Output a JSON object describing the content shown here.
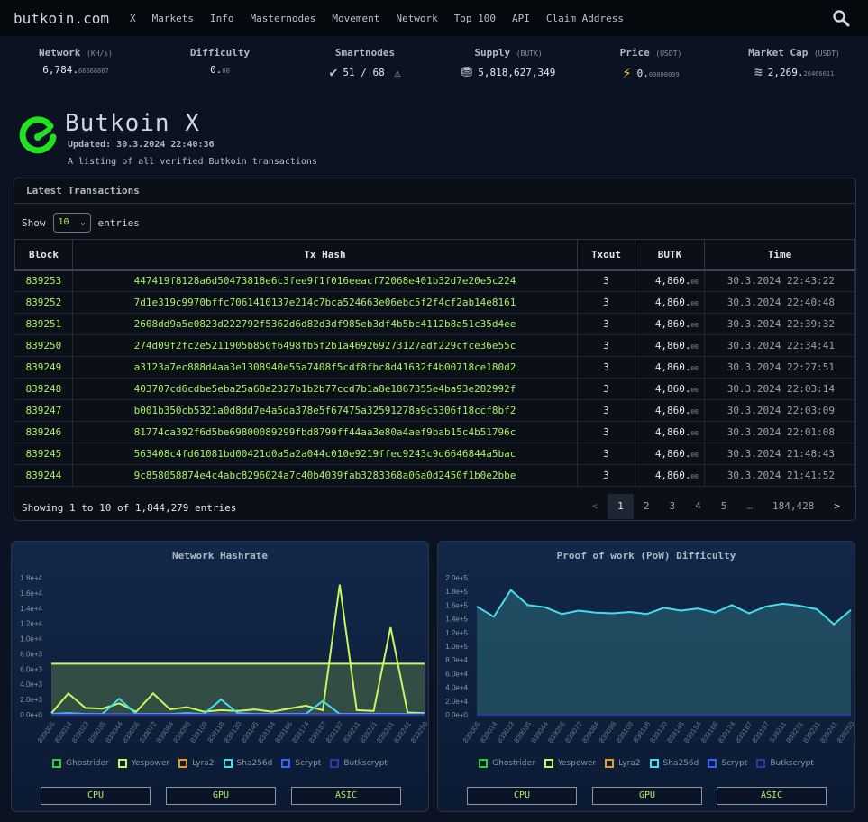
{
  "nav": {
    "brand": "butkoin.com",
    "links": [
      "X",
      "Markets",
      "Info",
      "Masternodes",
      "Movement",
      "Network",
      "Top 100",
      "API",
      "Claim Address"
    ]
  },
  "stats": {
    "network": {
      "label": "Network",
      "unit": "(KH/s)",
      "value": "6,784.",
      "decimals": "66666667"
    },
    "difficulty": {
      "label": "Difficulty",
      "value": "0.",
      "decimals": "00"
    },
    "smartnodes": {
      "label": "Smartnodes",
      "value": "51 / 68"
    },
    "supply": {
      "label": "Supply",
      "unit": "(BUTK)",
      "value": "5,818,627,349"
    },
    "price": {
      "label": "Price",
      "unit": "(USDT)",
      "value": "0.",
      "decimals": "00000039"
    },
    "marketcap": {
      "label": "Market Cap",
      "unit": "(USDT)",
      "value": "2,269.",
      "decimals": "26466611"
    }
  },
  "page": {
    "title": "Butkoin X",
    "updated": "Updated: 30.3.2024 22:40:36",
    "description": "A listing of all verified Butkoin transactions"
  },
  "transactions": {
    "heading": "Latest Transactions",
    "show_label": "Show",
    "entries_label": "entries",
    "page_size": "10",
    "columns": [
      "Block",
      "Tx Hash",
      "Txout",
      "BUTK",
      "Time"
    ],
    "rows": [
      {
        "block": "839253",
        "hash": "447419f8128a6d50473818e6c3fee9f1f016eeacf72068e401b32d7e20e5c224",
        "txout": "3",
        "amount": "4,860.",
        "dec": "00",
        "time": "30.3.2024 22:43:22"
      },
      {
        "block": "839252",
        "hash": "7d1e319c9970bffc7061410137e214c7bca524663e06ebc5f2f4cf2ab14e8161",
        "txout": "3",
        "amount": "4,860.",
        "dec": "00",
        "time": "30.3.2024 22:40:48"
      },
      {
        "block": "839251",
        "hash": "2608dd9a5e0823d222792f5362d6d82d3df985eb3df4b5bc4112b8a51c35d4ee",
        "txout": "3",
        "amount": "4,860.",
        "dec": "00",
        "time": "30.3.2024 22:39:32"
      },
      {
        "block": "839250",
        "hash": "274d09f2fc2e5211905b850f6498fb5f2b1a469269273127adf229cfce36e55c",
        "txout": "3",
        "amount": "4,860.",
        "dec": "00",
        "time": "30.3.2024 22:34:41"
      },
      {
        "block": "839249",
        "hash": "a3123a7ec888d4aa3e1308940e55a7408f5cdf8fbc8d41632f4b00718ce180d2",
        "txout": "3",
        "amount": "4,860.",
        "dec": "00",
        "time": "30.3.2024 22:27:51"
      },
      {
        "block": "839248",
        "hash": "403707cd6cdbe5eba25a68a2327b1b2b77ccd7b1a8e1867355e4ba93e282992f",
        "txout": "3",
        "amount": "4,860.",
        "dec": "00",
        "time": "30.3.2024 22:03:14"
      },
      {
        "block": "839247",
        "hash": "b001b350cb5321a0d8dd7e4a5da378e5f67475a32591278a9c5306f18ccf8bf2",
        "txout": "3",
        "amount": "4,860.",
        "dec": "00",
        "time": "30.3.2024 22:03:09"
      },
      {
        "block": "839246",
        "hash": "81774ca392f6d5be69800089299fbd8799ff44aa3e80a4aef9bab15c4b51796c",
        "txout": "3",
        "amount": "4,860.",
        "dec": "00",
        "time": "30.3.2024 22:01:08"
      },
      {
        "block": "839245",
        "hash": "563408c4fd61081bd00421d0a5a2a044c010e9219ffec9243c9d6646844a5bac",
        "txout": "3",
        "amount": "4,860.",
        "dec": "00",
        "time": "30.3.2024 21:48:43"
      },
      {
        "block": "839244",
        "hash": "9c858058874e4c4abc8296024a7c40b4039fab3283368a06a0d2450f1b0e2bbe",
        "txout": "3",
        "amount": "4,860.",
        "dec": "00",
        "time": "30.3.2024 21:41:52"
      }
    ],
    "showing": "Showing 1 to 10 of 1,844,279 entries",
    "pager": [
      "<",
      "1",
      "2",
      "3",
      "4",
      "5",
      "…",
      "184,428",
      ">"
    ],
    "active_page": "1"
  },
  "chart_data": [
    {
      "type": "line",
      "title": "Network Hashrate",
      "ylim": [
        0,
        18000
      ],
      "yticks": [
        "0.0e+0",
        "2.0e+3",
        "4.0e+3",
        "6.0e+3",
        "8.0e+3",
        "1.0e+4",
        "1.2e+4",
        "1.4e+4",
        "1.6e+4",
        "1.8e+4"
      ],
      "x_ticks": [
        "839005",
        "839014",
        "839023",
        "839035",
        "839044",
        "839056",
        "839072",
        "839084",
        "839098",
        "839109",
        "839118",
        "839130",
        "839145",
        "839154",
        "839166",
        "839174",
        "839187",
        "839197",
        "839211",
        "839221",
        "839231",
        "839241",
        "839250"
      ],
      "reference_line": 6700,
      "series": [
        {
          "name": "Ghostrider",
          "color": "#33cc33",
          "values": [
            60,
            60,
            60,
            60,
            80,
            60,
            60,
            60,
            60,
            60,
            60,
            60,
            60,
            60,
            60,
            60,
            60,
            60,
            60,
            60,
            60,
            60,
            60
          ]
        },
        {
          "name": "Yespower",
          "color": "#c8f560",
          "values": [
            200,
            2800,
            900,
            800,
            1500,
            400,
            2800,
            700,
            1000,
            400,
            600,
            500,
            700,
            400,
            800,
            1200,
            600,
            17100,
            600,
            500,
            11500,
            300,
            200
          ]
        },
        {
          "name": "Lyra2",
          "color": "#e0a030",
          "values": [
            0,
            0,
            0,
            0,
            0,
            0,
            0,
            0,
            0,
            0,
            0,
            0,
            0,
            0,
            0,
            0,
            0,
            0,
            0,
            0,
            0,
            0,
            0
          ]
        },
        {
          "name": "Sha256d",
          "color": "#44ddee",
          "values": [
            100,
            200,
            100,
            100,
            2100,
            100,
            100,
            100,
            200,
            100,
            2000,
            200,
            100,
            100,
            100,
            100,
            1800,
            100,
            100,
            100,
            100,
            100,
            100
          ]
        },
        {
          "name": "Scrypt",
          "color": "#3366ff",
          "values": [
            50,
            50,
            50,
            50,
            50,
            50,
            50,
            50,
            50,
            50,
            50,
            50,
            50,
            50,
            50,
            50,
            50,
            50,
            50,
            50,
            50,
            50,
            50
          ]
        },
        {
          "name": "Butkscrypt",
          "color": "#3333aa",
          "values": [
            0,
            0,
            0,
            0,
            0,
            0,
            0,
            0,
            0,
            0,
            0,
            0,
            0,
            0,
            0,
            0,
            0,
            0,
            0,
            0,
            0,
            0,
            0
          ]
        }
      ],
      "buttons": [
        "CPU",
        "GPU",
        "ASIC"
      ]
    },
    {
      "type": "line",
      "title": "Proof of work (PoW) Difficulty",
      "ylim": [
        0,
        200000
      ],
      "yticks": [
        "0.0e+0",
        "2.0e+4",
        "4.0e+4",
        "6.0e+4",
        "8.0e+4",
        "1.0e+5",
        "1.2e+5",
        "1.4e+5",
        "1.6e+5",
        "1.8e+5",
        "2.0e+5"
      ],
      "x_ticks": [
        "839005",
        "839014",
        "839023",
        "839035",
        "839044",
        "839056",
        "839072",
        "839084",
        "839098",
        "839109",
        "839118",
        "839130",
        "839145",
        "839154",
        "839166",
        "839174",
        "839187",
        "839197",
        "839211",
        "839221",
        "839231",
        "839241",
        "839250"
      ],
      "series": [
        {
          "name": "Ghostrider",
          "color": "#33cc33",
          "values": [
            0,
            0,
            0,
            0,
            0,
            0,
            0,
            0,
            0,
            0,
            0,
            0,
            0,
            0,
            0,
            0,
            0,
            0,
            0,
            0,
            0,
            0,
            0
          ]
        },
        {
          "name": "Yespower",
          "color": "#c8f560",
          "values": [
            0,
            0,
            0,
            0,
            0,
            0,
            0,
            0,
            0,
            0,
            0,
            0,
            0,
            0,
            0,
            0,
            0,
            0,
            0,
            0,
            0,
            0,
            0
          ]
        },
        {
          "name": "Lyra2",
          "color": "#e0a030",
          "values": [
            0,
            0,
            0,
            0,
            0,
            0,
            0,
            0,
            0,
            0,
            0,
            0,
            0,
            0,
            0,
            0,
            0,
            0,
            0,
            0,
            0,
            0,
            0
          ]
        },
        {
          "name": "Sha256d",
          "color": "#44ddee",
          "values": [
            158000,
            143000,
            182000,
            160000,
            157000,
            147000,
            152000,
            149000,
            148000,
            150000,
            147000,
            156000,
            152000,
            155000,
            149000,
            160000,
            148000,
            158000,
            162000,
            159000,
            154000,
            132000,
            153000
          ]
        },
        {
          "name": "Scrypt",
          "color": "#3366ff",
          "values": [
            0,
            0,
            0,
            0,
            0,
            0,
            0,
            0,
            0,
            0,
            0,
            0,
            0,
            0,
            0,
            0,
            0,
            0,
            0,
            0,
            0,
            0,
            0
          ]
        },
        {
          "name": "Butkscrypt",
          "color": "#3333aa",
          "values": [
            0,
            0,
            0,
            0,
            0,
            0,
            0,
            0,
            0,
            0,
            0,
            0,
            0,
            0,
            0,
            0,
            0,
            0,
            0,
            0,
            0,
            0,
            0
          ]
        }
      ],
      "buttons": [
        "CPU",
        "GPU",
        "ASIC"
      ]
    }
  ]
}
